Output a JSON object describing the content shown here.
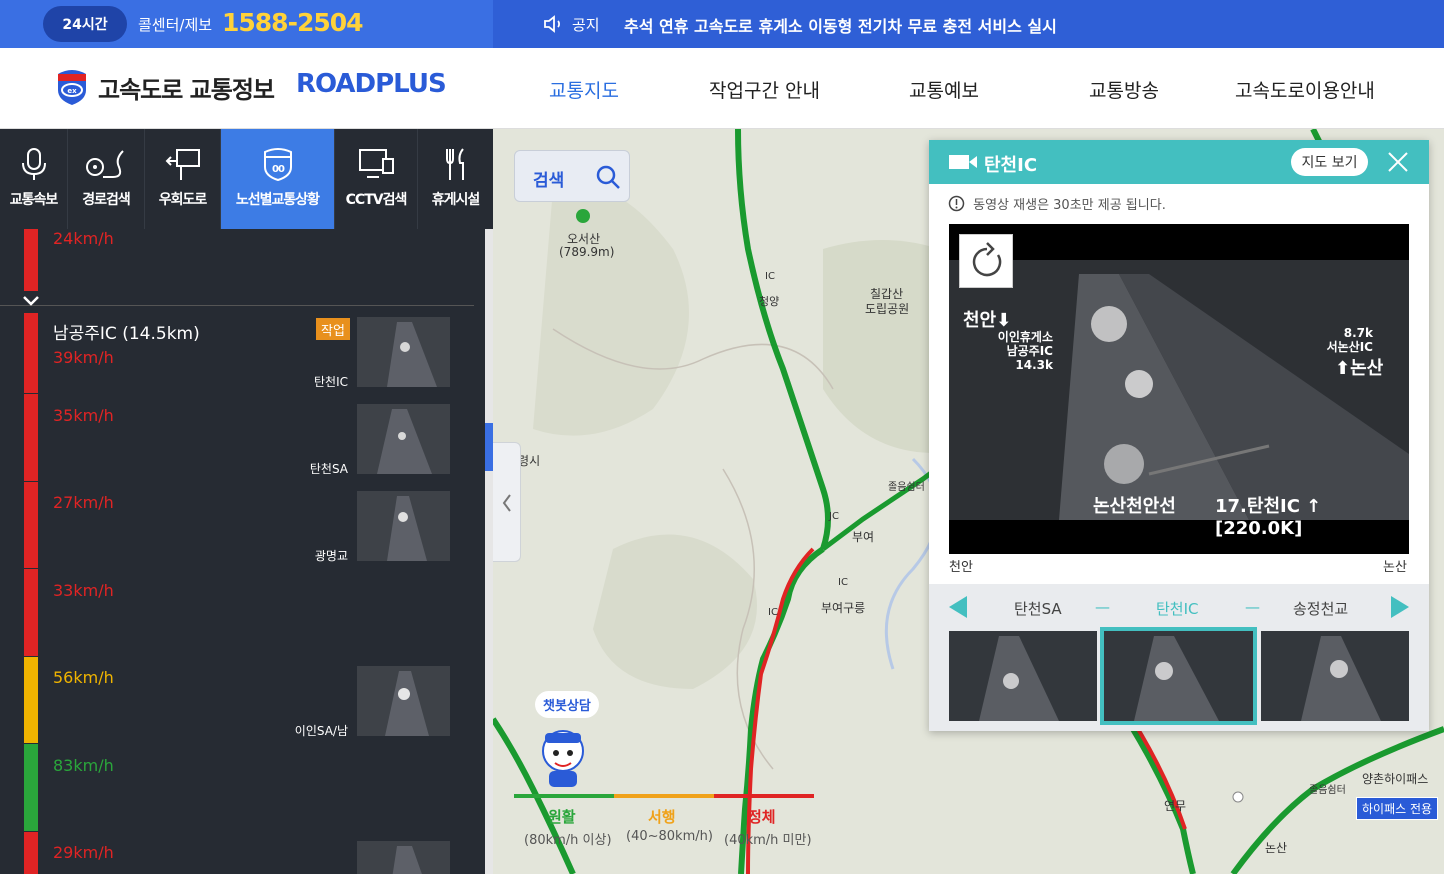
{
  "topbar": {
    "badge_24": "24시간",
    "callcenter_label": "콜센터/제보",
    "callcenter_number": "1588-2504",
    "notice_label": "공지",
    "notice_text": "추석 연휴 고속도로 휴게소 이동형 전기차 무료 충전 서비스 실시"
  },
  "header": {
    "logo_ko": "고속도로 교통정보",
    "logo_en": "ROADPLUS",
    "nav": [
      "교통지도",
      "작업구간 안내",
      "교통예보",
      "교통방송",
      "고속도로이용안내"
    ],
    "active_nav": "교통지도"
  },
  "sidebar": {
    "tabs": [
      {
        "label": "교통속보",
        "icon": "microphone-icon"
      },
      {
        "label": "경로검색",
        "icon": "route-icon"
      },
      {
        "label": "우회도로",
        "icon": "detour-sign-icon"
      },
      {
        "label": "노선별교통상황",
        "icon": "highway-shield-icon"
      },
      {
        "label": "CCTV검색",
        "icon": "cctv-monitor-icon"
      },
      {
        "label": "휴게시설",
        "icon": "restaurant-icon"
      }
    ],
    "active_tab": "노선별교통상황",
    "top_speed": "24km/h",
    "ic_title": "남공주IC (14.5km)",
    "work_badge": "작업",
    "segments": [
      {
        "speed": "39km/h",
        "status": "congested",
        "cctv_label": "탄천IC"
      },
      {
        "speed": "35km/h",
        "status": "congested",
        "cctv_label": "탄천SA"
      },
      {
        "speed": "27km/h",
        "status": "congested",
        "cctv_label": "광명교"
      },
      {
        "speed": "33km/h",
        "status": "congested",
        "cctv_label": ""
      },
      {
        "speed": "56km/h",
        "status": "slow",
        "cctv_label": "이인SA/남"
      },
      {
        "speed": "83km/h",
        "status": "smooth",
        "cctv_label": ""
      },
      {
        "speed": "29km/h",
        "status": "congested",
        "cctv_label": ""
      }
    ]
  },
  "map": {
    "search_label": "검색",
    "labels": [
      "오서산",
      "(789.9m)",
      "칠갑산",
      "도립공원",
      "보령시",
      "부여",
      "부여구릉",
      "졸음쉼터",
      "청양",
      "연무",
      "논산",
      "양촌하이패스",
      "졸음쉼터",
      "IC",
      "IC",
      "JC",
      "IC"
    ],
    "chatbot": "챗봇상담",
    "hipass_label": "하이패스 전용",
    "legend": [
      {
        "name": "원활",
        "range": "(80km/h 이상)",
        "color": "#2aa63b"
      },
      {
        "name": "서행",
        "range": "(40~80km/h)",
        "color": "#f0a21a"
      },
      {
        "name": "정체",
        "range": "(40km/h 미만)",
        "color": "#e02424"
      }
    ]
  },
  "cctv": {
    "title": "탄천IC",
    "map_view_button": "지도 보기",
    "notice": "동영상 재생은 30초만 제공 됩니다.",
    "overlay": {
      "left_dir": "천안",
      "left_info_1": "이인휴게소",
      "left_info_2": "남공주IC",
      "left_info_3": "14.3k",
      "right_info_1": "8.7k",
      "right_info_2": "서논산IC",
      "right_dir": "논산",
      "bottom_left": "논산천안선",
      "bottom_right": "17.탄천IC ↑ [220.0K]"
    },
    "direction_left": "천안",
    "direction_right": "논산",
    "nav": {
      "prev": "탄천SA",
      "current": "탄천IC",
      "next": "송정천교",
      "sep": "—"
    }
  },
  "colors": {
    "congested": "#e02424",
    "slow": "#f0b400",
    "smooth": "#2aa63b",
    "accent": "#3a6fe3",
    "teal": "#43bfc0"
  }
}
